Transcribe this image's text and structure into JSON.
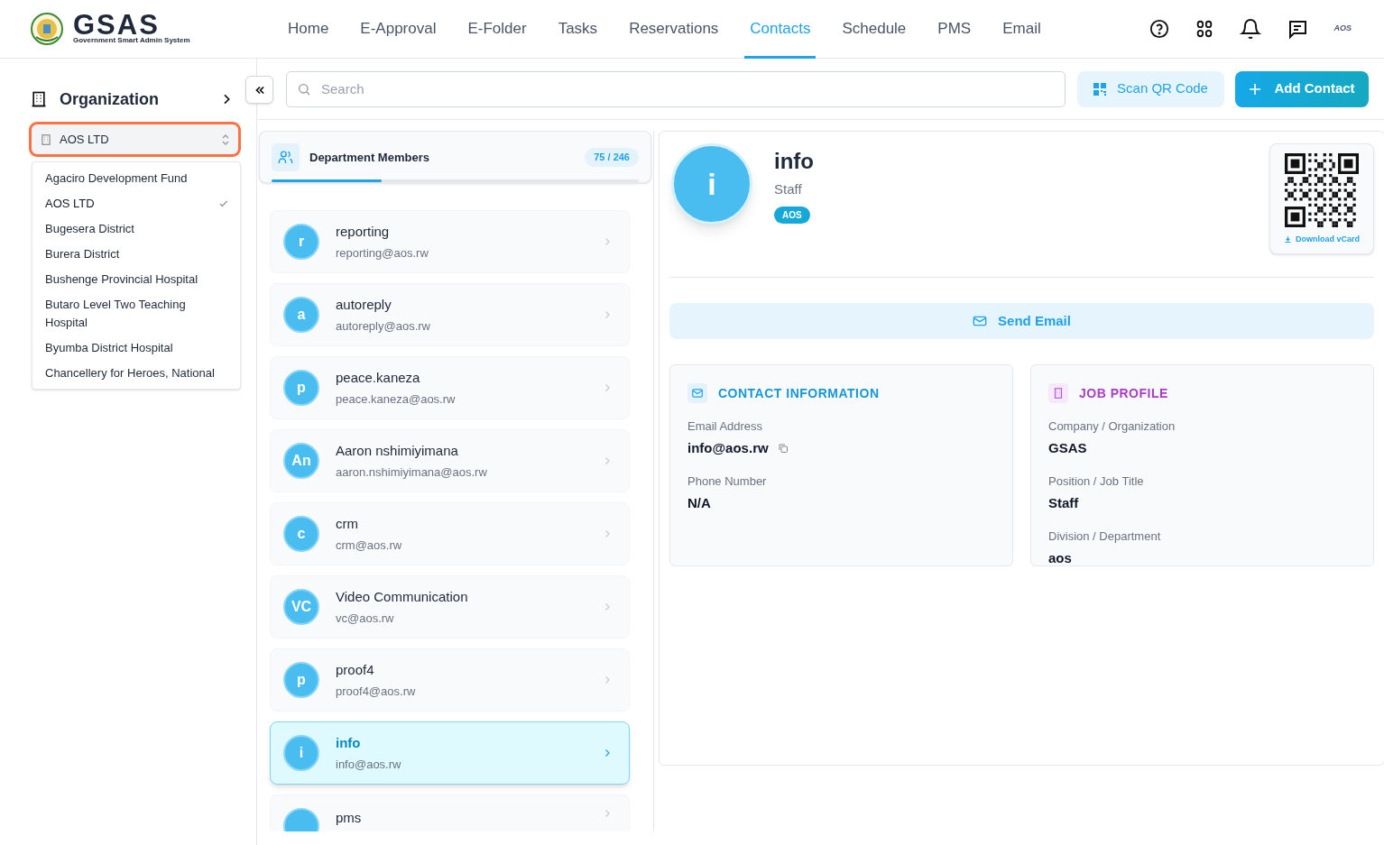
{
  "header": {
    "logo_text": "GSAS",
    "logo_subtitle": "Government Smart Admin System",
    "avatar_text": "AOS",
    "nav": [
      {
        "label": "Home",
        "selected": false
      },
      {
        "label": "E-Approval",
        "selected": false
      },
      {
        "label": "E-Folder",
        "selected": false
      },
      {
        "label": "Tasks",
        "selected": false
      },
      {
        "label": "Reservations",
        "selected": false
      },
      {
        "label": "Contacts",
        "selected": true
      },
      {
        "label": "Schedule",
        "selected": false
      },
      {
        "label": "PMS",
        "selected": false
      },
      {
        "label": "Email",
        "selected": false
      }
    ]
  },
  "sidebar": {
    "title": "Organization",
    "select_value": "AOS LTD",
    "options": [
      {
        "label": "Agaciro Development Fund",
        "selected": false
      },
      {
        "label": "AOS LTD",
        "selected": true
      },
      {
        "label": "Bugesera District",
        "selected": false
      },
      {
        "label": "Burera District",
        "selected": false
      },
      {
        "label": "Bushenge Provincial Hospital",
        "selected": false
      },
      {
        "label": "Butaro Level Two Teaching Hospital",
        "selected": false
      },
      {
        "label": "Byumba District Hospital",
        "selected": false
      },
      {
        "label": "Chancellery for Heroes, National",
        "selected": false
      }
    ]
  },
  "search": {
    "placeholder": "Search"
  },
  "toolbar": {
    "scan_button": "Scan QR Code",
    "add_button": "Add Contact"
  },
  "members": {
    "title": "Department Members",
    "count": "75 / 246",
    "level": 0.3,
    "contacts": [
      {
        "initials": "r",
        "name": "reporting",
        "email": "reporting@aos.rw",
        "selected": false
      },
      {
        "initials": "a",
        "name": "autoreply",
        "email": "autoreply@aos.rw",
        "selected": false
      },
      {
        "initials": "p",
        "name": "peace.kaneza",
        "email": "peace.kaneza@aos.rw",
        "selected": false
      },
      {
        "initials": "An",
        "name": "Aaron nshimiyimana",
        "email": "aaron.nshimiyimana@aos.rw",
        "selected": false
      },
      {
        "initials": "c",
        "name": "crm",
        "email": "crm@aos.rw",
        "selected": false
      },
      {
        "initials": "VC",
        "name": "Video Communication",
        "email": "vc@aos.rw",
        "selected": false
      },
      {
        "initials": "p",
        "name": "proof4",
        "email": "proof4@aos.rw",
        "selected": false
      },
      {
        "initials": "i",
        "name": "info",
        "email": "info@aos.rw",
        "selected": true
      },
      {
        "name": "pms",
        "selected": false
      }
    ]
  },
  "detail": {
    "initials": "i",
    "name": "info",
    "role": "Staff",
    "badge": "AOS",
    "download": "Download vCard",
    "send_button": "Send Email",
    "sections": [
      {
        "kind": "contact",
        "title": "CONTACT INFORMATION",
        "fields": [
          {
            "label": "Email Address",
            "value": "info@aos.rw",
            "copyable": true
          },
          {
            "label": "Phone Number",
            "value": "N/A",
            "copyable": false
          }
        ]
      },
      {
        "kind": "job",
        "title": "JOB PROFILE",
        "fields": [
          {
            "label": "Company / Organization",
            "value": "GSAS",
            "copyable": false
          },
          {
            "label": "Position / Job Title",
            "value": "Staff",
            "copyable": false
          },
          {
            "label": "Division / Department",
            "value": "aos",
            "copyable": false
          }
        ]
      }
    ]
  }
}
